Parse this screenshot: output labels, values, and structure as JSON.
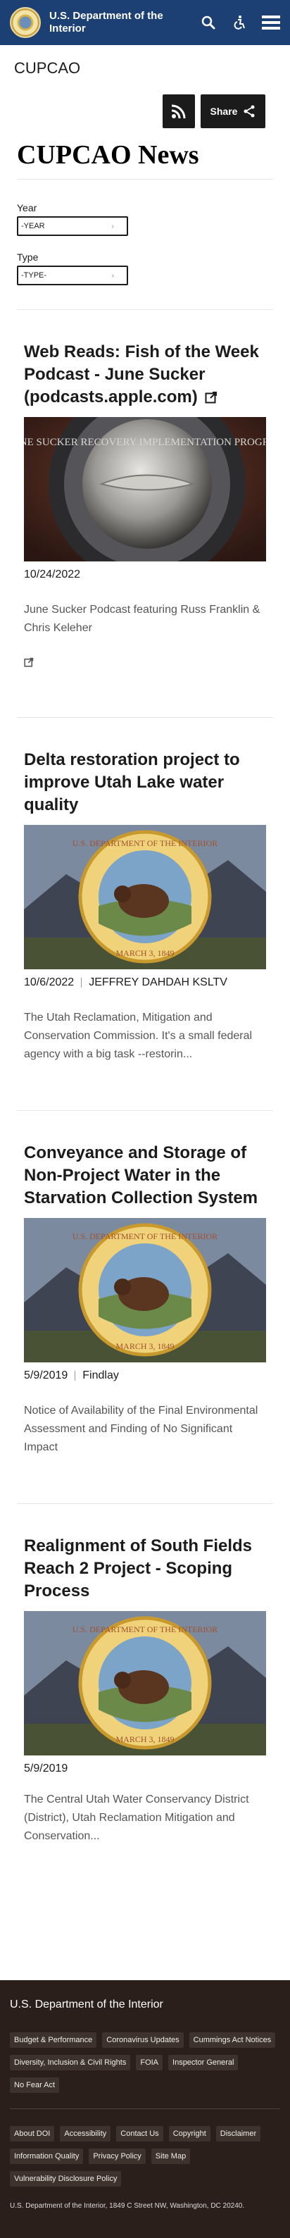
{
  "header": {
    "title": "U.S. Department of the Interior",
    "icons": [
      "search-icon",
      "accessibility-icon",
      "menu-icon"
    ]
  },
  "page_label": "CUPCAO",
  "share": {
    "label": "Share"
  },
  "main_title": "CUPCAO News",
  "filters": {
    "year_label": "Year",
    "year_value": "-YEAR",
    "type_label": "Type",
    "type_value": "-TYPE-"
  },
  "cards": [
    {
      "title": "Web Reads: Fish of the Week Podcast - June Sucker (podcasts.apple.com)",
      "date": "10/24/2022",
      "author": "",
      "summary": "June Sucker Podcast featuring Russ Franklin & Chris Keleher",
      "image": "june-sucker-coin-image"
    },
    {
      "title": "Delta restoration project to improve Utah Lake water quality",
      "date": "10/6/2022",
      "author": "JEFFREY DAHDAH KSLTV",
      "summary": "The Utah Reclamation, Mitigation and Conservation Commission. It's a small federal agency with a big task --restorin...",
      "image": "doi-seal-image"
    },
    {
      "title": "Conveyance and Storage of Non-Project Water in the Starvation Collection System",
      "date": "5/9/2019",
      "author": "Findlay",
      "summary": "Notice of Availability of the Final Environmental Assessment and Finding of No Significant Impact",
      "image": "doi-seal-image"
    },
    {
      "title": "Realignment of South Fields Reach 2 Project - Scoping Process",
      "date": "5/9/2019",
      "author": "",
      "summary": "The Central Utah Water Conservancy District (District), Utah Reclamation Mitigation and Conservation...",
      "image": "doi-seal-image"
    }
  ],
  "seal_text": {
    "top": "U.S. DEPARTMENT OF THE INTERIOR",
    "bottom": "MARCH 3, 1849"
  },
  "coin_text": "JUNE SUCKER RECOVERY IMPLEMENTATION PROGRAM",
  "footer": {
    "title": "U.S. Department of the Interior",
    "group1": [
      "Budget & Performance",
      "Coronavirus Updates",
      "Cummings Act Notices",
      "Diversity, Inclusion & Civil Rights",
      "FOIA",
      "Inspector General",
      "No Fear Act"
    ],
    "group2": [
      "About DOI",
      "Accessibility",
      "Contact Us",
      "Copyright",
      "Disclaimer",
      "Information Quality",
      "Privacy Policy",
      "Site Map",
      "Vulnerability Disclosure Policy"
    ],
    "address": "U.S. Department of the Interior, 1849 C Street NW, Washington, DC 20240."
  },
  "colors": {
    "header_bg": "#1c3f74",
    "footer_bg": "#2a1f1a",
    "button_bg": "#1b1b1b"
  }
}
